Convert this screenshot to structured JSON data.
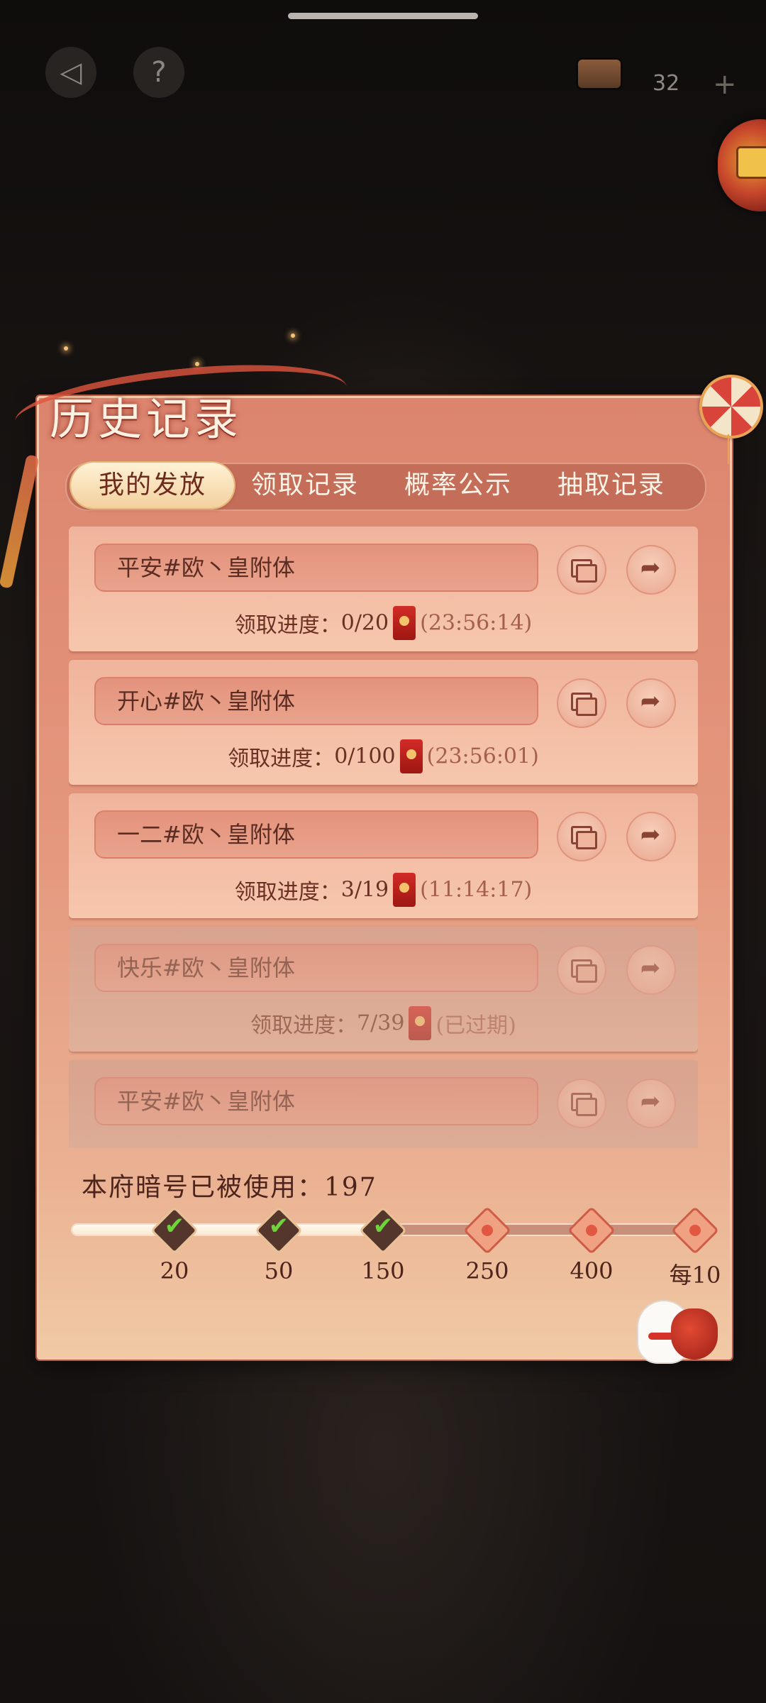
{
  "status": {
    "currency_count": "32"
  },
  "title": "历史记录",
  "tabs": [
    {
      "label": "我的发放",
      "active": true
    },
    {
      "label": "领取记录",
      "active": false
    },
    {
      "label": "概率公示",
      "active": false
    },
    {
      "label": "抽取记录",
      "active": false
    }
  ],
  "records": [
    {
      "name": "平安#欧丶皇附体",
      "progress_label": "领取进度：",
      "progress": "0/20",
      "time": "(23:56:14)",
      "expired": false
    },
    {
      "name": "开心#欧丶皇附体",
      "progress_label": "领取进度：",
      "progress": "0/100",
      "time": "(23:56:01)",
      "expired": false
    },
    {
      "name": "一二#欧丶皇附体",
      "progress_label": "领取进度：",
      "progress": "3/19",
      "time": "(11:14:17)",
      "expired": false
    },
    {
      "name": "快乐#欧丶皇附体",
      "progress_label": "领取进度：",
      "progress": "7/39",
      "time": "(已过期)",
      "expired": true
    },
    {
      "name": "平安#欧丶皇附体",
      "progress_label": "",
      "progress": "",
      "time": "",
      "expired": true
    }
  ],
  "usage": {
    "label": "本府暗号已被使用：",
    "count": "197",
    "progress_fraction": 0.52,
    "milestones": [
      {
        "label": "20",
        "reached": true
      },
      {
        "label": "50",
        "reached": true
      },
      {
        "label": "150",
        "reached": true
      },
      {
        "label": "250",
        "reached": false
      },
      {
        "label": "400",
        "reached": false
      },
      {
        "label": "每10",
        "reached": false
      }
    ]
  },
  "icons": {
    "back": "back-arrow-icon",
    "help": "help-icon",
    "copy": "copy-icon",
    "share": "share-icon",
    "envelope": "red-envelope-icon",
    "close": "close-icon"
  },
  "colors": {
    "panel": "#e4977d",
    "active_tab": "#f3d09e",
    "check": "#6fd43c",
    "envelope": "#d22b26"
  }
}
